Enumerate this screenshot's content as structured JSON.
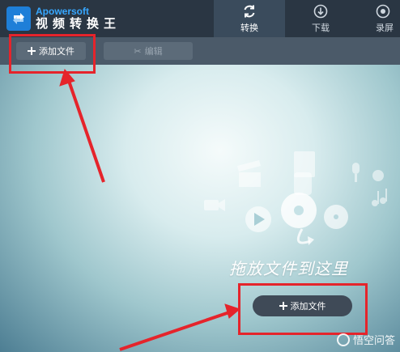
{
  "app": {
    "brand_top": "Apowersoft",
    "brand_bottom": "视频转换王"
  },
  "tabs": [
    {
      "label": "转换",
      "icon": "refresh-icon",
      "active": true
    },
    {
      "label": "下载",
      "icon": "download-icon",
      "active": false
    },
    {
      "label": "录屏",
      "icon": "record-icon",
      "active": false
    }
  ],
  "toolbar": {
    "add_label": "添加文件",
    "edit_label": "编辑"
  },
  "main": {
    "drop_text": "拖放文件到这里",
    "add_label": "添加文件"
  },
  "watermark": {
    "text": "悟空问答"
  },
  "colors": {
    "header_bg": "#2a3643",
    "toolbar_bg": "#4b5a69",
    "active_tab_bg": "#3a4b5c",
    "brand_accent": "#37a7ff",
    "annotation_red": "#e5242b"
  }
}
